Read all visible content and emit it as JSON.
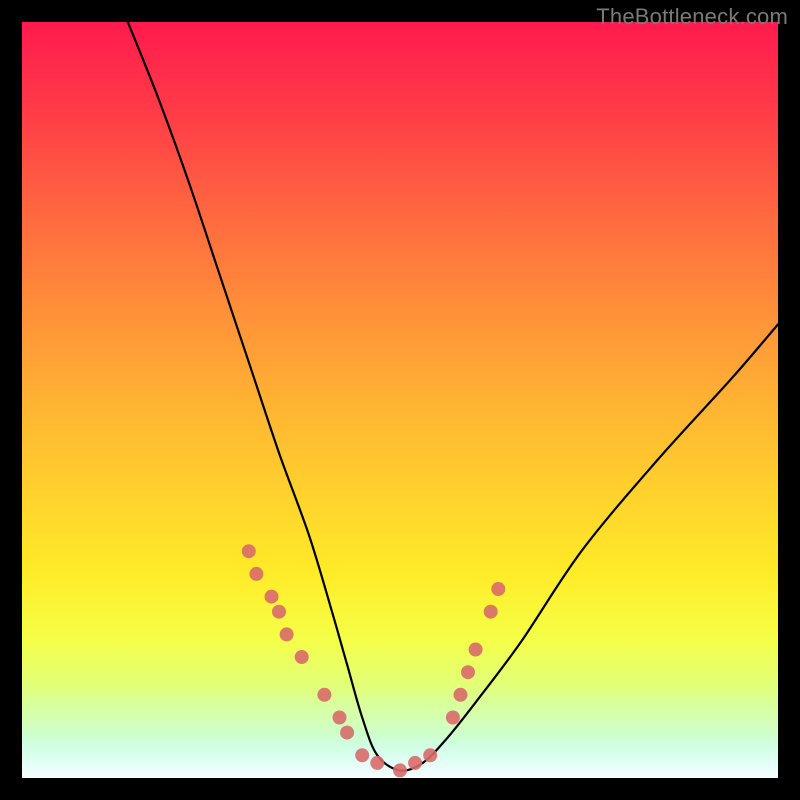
{
  "watermark": "TheBottleneck.com",
  "chart_data": {
    "type": "line",
    "title": "",
    "xlabel": "",
    "ylabel": "",
    "xlim": [
      0,
      100
    ],
    "ylim": [
      0,
      100
    ],
    "grid": false,
    "legend": false,
    "series": [
      {
        "name": "bottleneck-curve",
        "x": [
          14,
          18,
          22,
          26,
          30,
          34,
          38,
          41,
          43,
          45,
          47,
          50,
          53,
          56,
          60,
          66,
          74,
          84,
          94,
          100
        ],
        "values": [
          100,
          90,
          79,
          67,
          55,
          43,
          32,
          22,
          15,
          8,
          3,
          1,
          2,
          5,
          10,
          18,
          30,
          42,
          53,
          60
        ]
      }
    ],
    "markers": {
      "name": "highlighted-points",
      "color": "#d86a6a",
      "points": [
        {
          "x": 30,
          "y": 30
        },
        {
          "x": 31,
          "y": 27
        },
        {
          "x": 33,
          "y": 24
        },
        {
          "x": 34,
          "y": 22
        },
        {
          "x": 35,
          "y": 19
        },
        {
          "x": 37,
          "y": 16
        },
        {
          "x": 40,
          "y": 11
        },
        {
          "x": 42,
          "y": 8
        },
        {
          "x": 43,
          "y": 6
        },
        {
          "x": 45,
          "y": 3
        },
        {
          "x": 47,
          "y": 2
        },
        {
          "x": 50,
          "y": 1
        },
        {
          "x": 52,
          "y": 2
        },
        {
          "x": 54,
          "y": 3
        },
        {
          "x": 57,
          "y": 8
        },
        {
          "x": 58,
          "y": 11
        },
        {
          "x": 59,
          "y": 14
        },
        {
          "x": 60,
          "y": 17
        },
        {
          "x": 62,
          "y": 22
        },
        {
          "x": 63,
          "y": 25
        }
      ]
    },
    "background": {
      "type": "vertical-gradient",
      "stops": [
        {
          "pos": 0.0,
          "color": "#ff1a4d"
        },
        {
          "pos": 0.5,
          "color": "#ffb233"
        },
        {
          "pos": 0.8,
          "color": "#f3ff2f"
        },
        {
          "pos": 1.0,
          "color": "#00ffc4"
        }
      ]
    }
  }
}
